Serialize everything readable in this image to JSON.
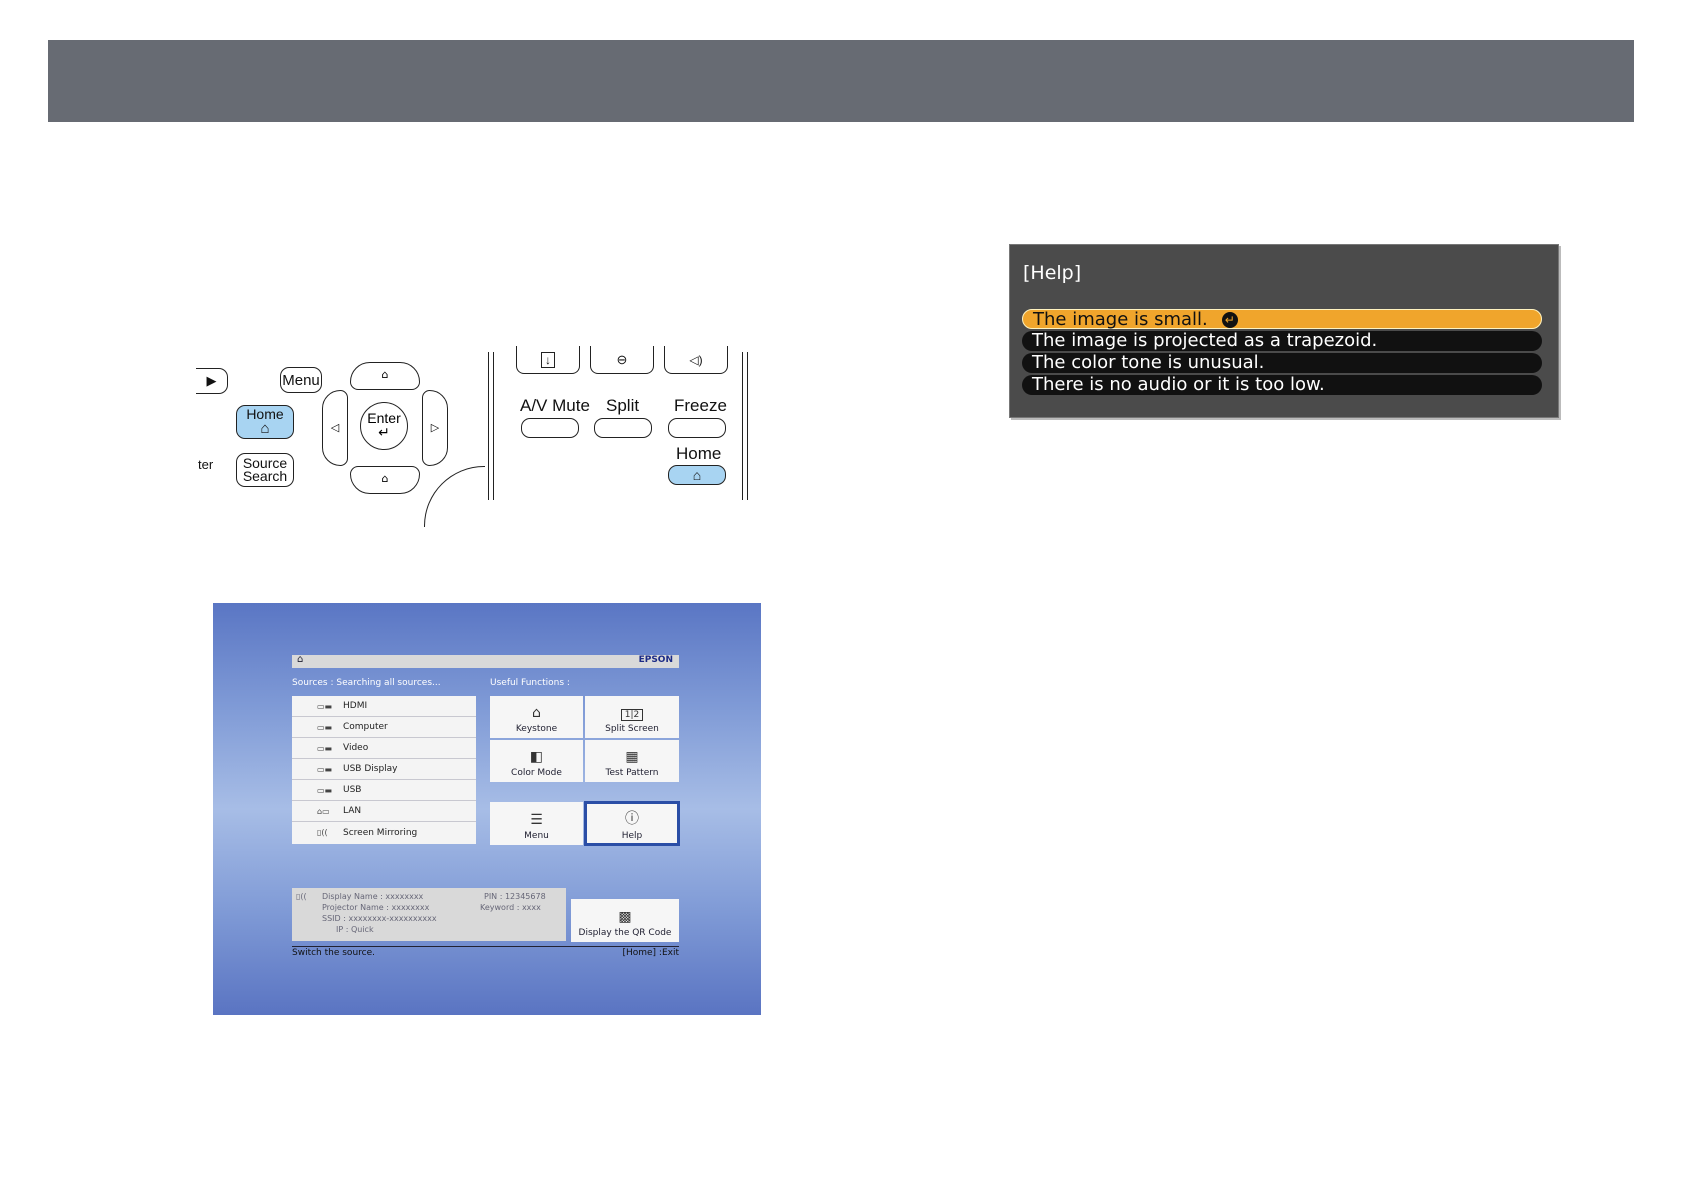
{
  "remote": {
    "left": {
      "menu": "Menu",
      "home": "Home",
      "enter": "Enter",
      "source_line1": "Source",
      "source_line2": "Search",
      "partial_label": "ter",
      "play": "▶"
    },
    "right": {
      "av_mute": "A/V Mute",
      "split": "Split",
      "freeze": "Freeze",
      "home": "Home"
    }
  },
  "home_screen": {
    "brand": "EPSON",
    "sources_heading": "Sources :  Searching all sources...",
    "useful_heading": "Useful Functions :",
    "sources": [
      {
        "icon": "▭▬",
        "label": "HDMI"
      },
      {
        "icon": "▭▬",
        "label": "Computer"
      },
      {
        "icon": "▭▬",
        "label": "Video"
      },
      {
        "icon": "▭▬",
        "label": "USB Display"
      },
      {
        "icon": "▭▬",
        "label": "USB"
      },
      {
        "icon": "⌂▭",
        "label": "LAN"
      },
      {
        "icon": "▯((",
        "label": "Screen Mirroring"
      }
    ],
    "functions": {
      "keystone": "Keystone",
      "split_screen": "Split Screen",
      "color_mode": "Color Mode",
      "test_pattern": "Test Pattern",
      "menu": "Menu",
      "help": "Help",
      "qr": "Display the QR Code"
    },
    "info": {
      "display_name": "Display Name :   xxxxxxxx",
      "projector_name": "Projector Name :   xxxxxxxx",
      "ssid": "SSID  :   xxxxxxxx-xxxxxxxxxx",
      "ip": "IP  :   Quick",
      "pin": "PIN :  12345678",
      "keyword": "Keyword :  xxxx"
    },
    "footer_left": "Switch the source.",
    "footer_right": "[Home] :Exit"
  },
  "help_panel": {
    "title": "[Help]",
    "items": [
      "The image is small.",
      "The image is projected as a trapezoid.",
      "The color tone is unusual.",
      "There is no audio or it is too low."
    ],
    "selected_index": 0
  },
  "colors": {
    "banner": "#676b73",
    "help_bg": "#4b4b4b",
    "help_selected": "#f0a52c",
    "home_button": "#a8d4f2"
  }
}
